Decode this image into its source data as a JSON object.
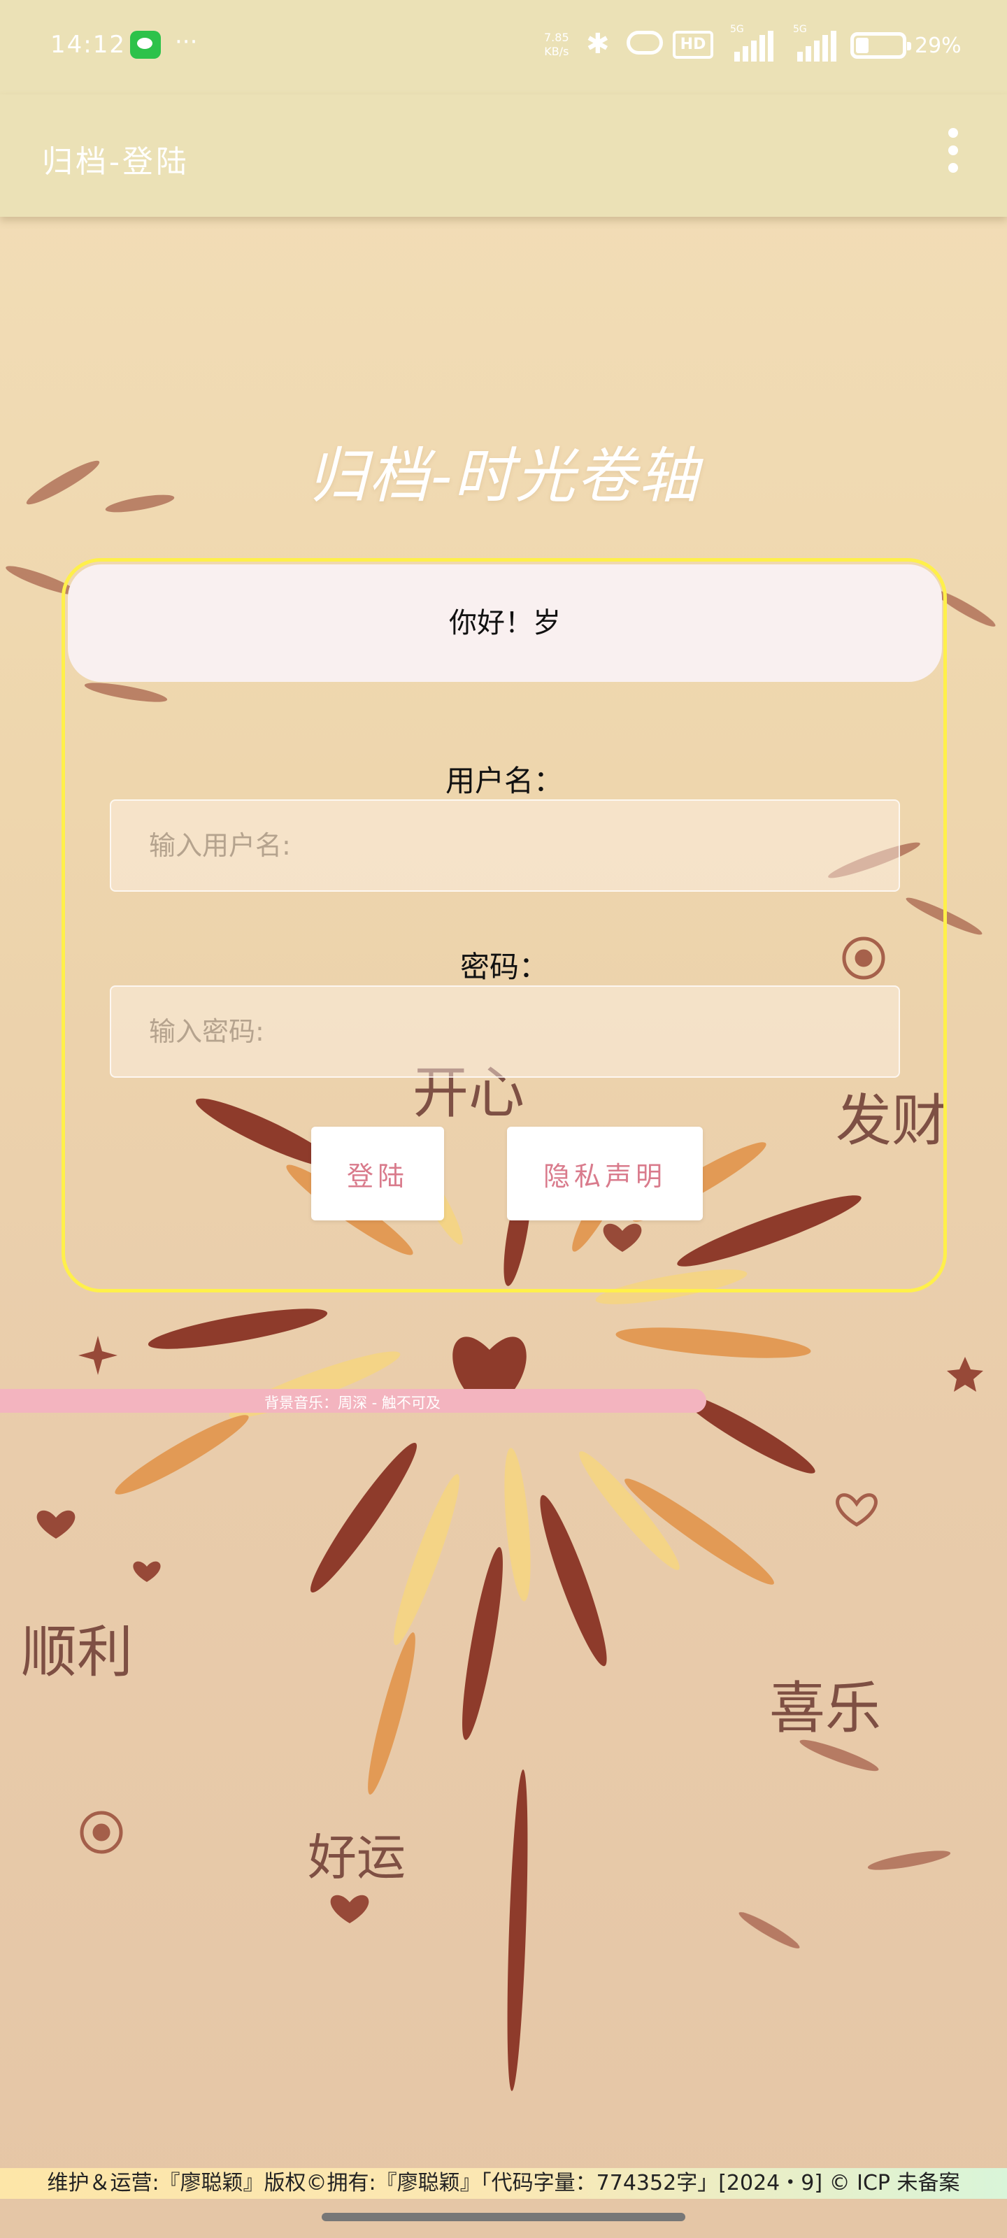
{
  "status_bar": {
    "time": "14:12",
    "app_icons": [
      "wechat-icon"
    ],
    "more": "···",
    "speed_value": "7.85",
    "speed_unit": "KB/s",
    "hd_label": "HD",
    "network_1": "5G",
    "network_2": "5G",
    "battery": "29%"
  },
  "app_bar": {
    "title": "归档-登陆",
    "menu_icon": "more-vertical-icon"
  },
  "main": {
    "heading": "归档-时光卷轴",
    "greeting": "你好！岁",
    "username": {
      "label": "用户名：",
      "placeholder": "输入用户名:"
    },
    "password": {
      "label": "密码：",
      "placeholder": "输入密码:"
    },
    "login_button": "登陆",
    "privacy_button": "隐私声明"
  },
  "background_words": [
    "开心",
    "发财",
    "顺利",
    "喜乐",
    "好运"
  ],
  "music_bar": {
    "text": "背景音乐：周深 - 触不可及"
  },
  "footer": {
    "text": "维护＆运营:『廖聪颖』版权©拥有:『廖聪颖』「代码字量：774352字」[2024・9] © ICP 未备案"
  },
  "colors": {
    "app_bar": "#ebe1b6",
    "card_border": "#fff04a",
    "button_text": "#d97b8c",
    "music_bar": "#f3b4bf",
    "firework_dark": "#8e3b2b",
    "firework_orange": "#e29a55",
    "firework_yellow": "#f4d486"
  }
}
